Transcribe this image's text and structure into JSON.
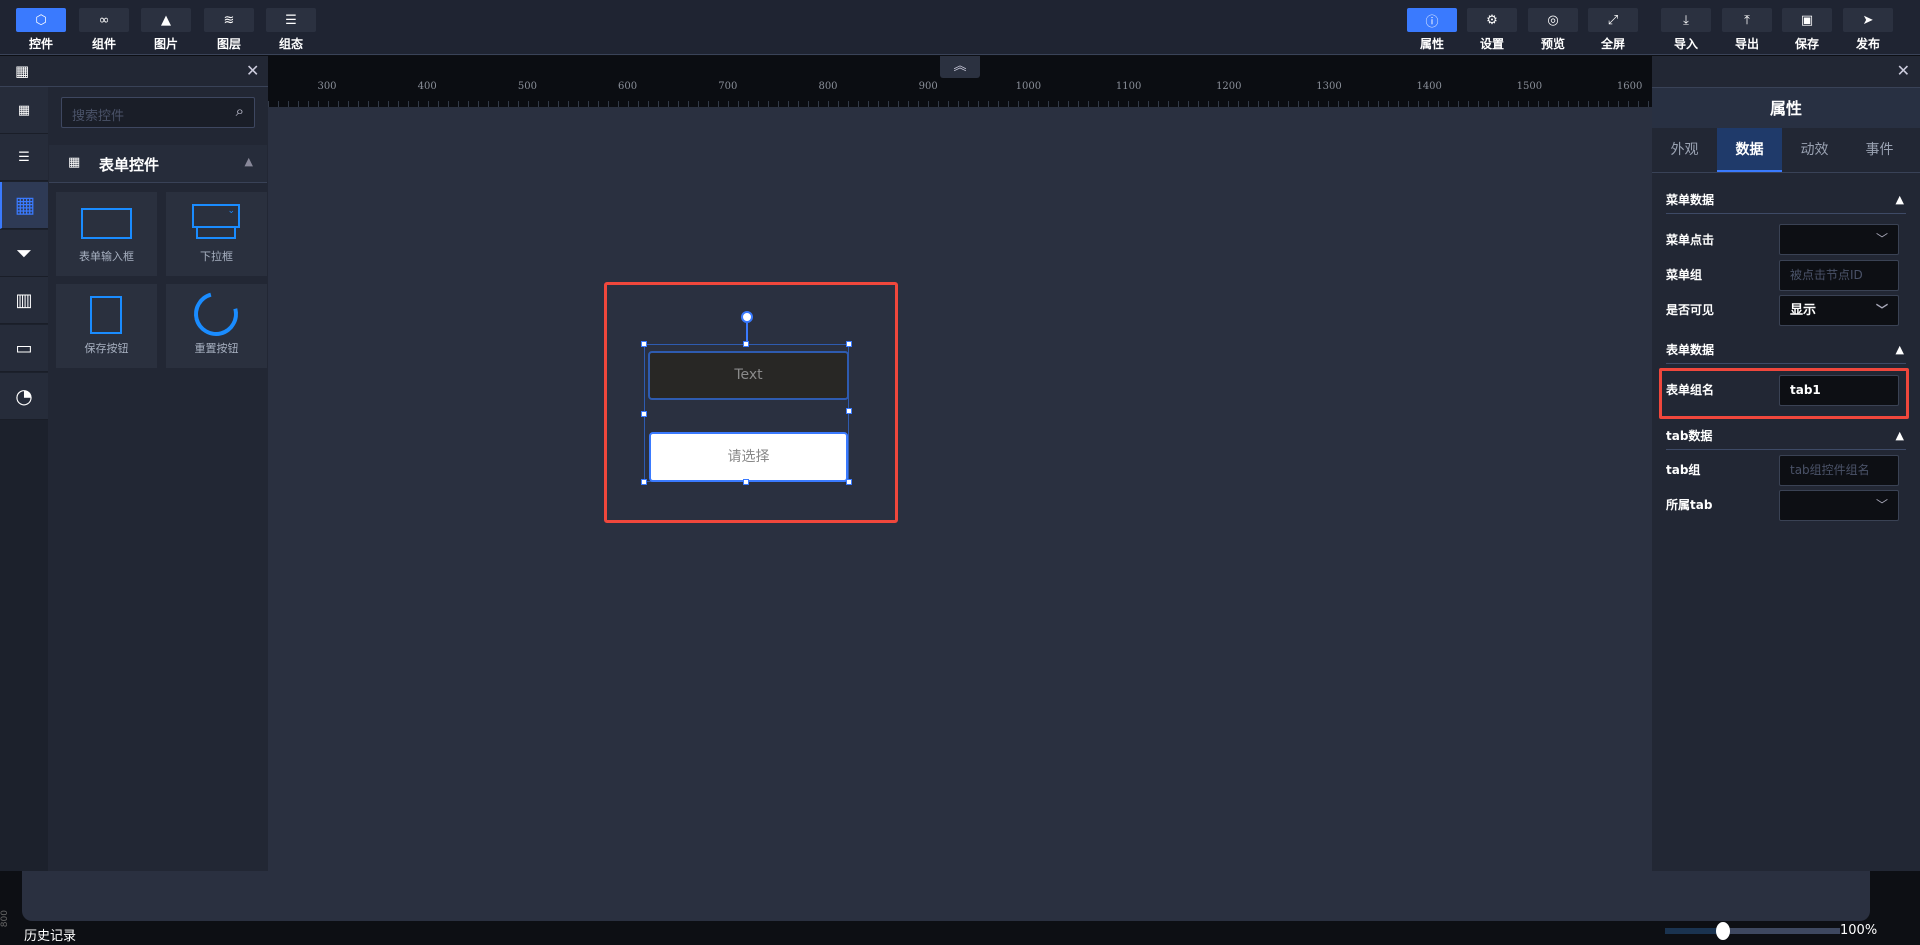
{
  "toolbar": {
    "left": [
      {
        "label": "控件",
        "icon": "cube-icon",
        "active": true
      },
      {
        "label": "组件",
        "icon": "link-icon"
      },
      {
        "label": "图片",
        "icon": "image-icon"
      },
      {
        "label": "图层",
        "icon": "layers-icon"
      },
      {
        "label": "组态",
        "icon": "align-icon"
      }
    ],
    "right": [
      {
        "label": "属性",
        "icon": "info-icon",
        "active": true
      },
      {
        "label": "设置",
        "icon": "gear-icon"
      },
      {
        "label": "预览",
        "icon": "eye-icon"
      },
      {
        "label": "全屏",
        "icon": "fullscreen-icon"
      },
      {
        "label": "导入",
        "icon": "import-icon"
      },
      {
        "label": "导出",
        "icon": "export-icon"
      },
      {
        "label": "保存",
        "icon": "save-icon"
      },
      {
        "label": "发布",
        "icon": "send-icon"
      }
    ]
  },
  "left_panel": {
    "search_placeholder": "搜索控件",
    "section": "表单控件",
    "tiles": [
      {
        "label": "表单输入框"
      },
      {
        "label": "下拉框"
      },
      {
        "label": "保存按钮"
      },
      {
        "label": "重置按钮"
      }
    ]
  },
  "ruler": {
    "ticks": [
      "300",
      "400",
      "500",
      "600",
      "700",
      "800",
      "900",
      "1000",
      "1100",
      "1200",
      "1300",
      "1400",
      "1500",
      "1600"
    ],
    "side_tick": "800"
  },
  "canvas": {
    "text_widget": "Text",
    "select_widget": "请选择"
  },
  "right_panel": {
    "title": "属性",
    "tabs": [
      "外观",
      "数据",
      "动效",
      "事件"
    ],
    "active_tab": "数据",
    "sections": {
      "menu": "菜单数据",
      "form": "表单数据",
      "tab": "tab数据"
    },
    "fields": {
      "menu_click": {
        "label": "菜单点击",
        "value": ""
      },
      "menu_group": {
        "label": "菜单组",
        "placeholder": "被点击节点ID"
      },
      "visible": {
        "label": "是否可见",
        "value": "显示"
      },
      "form_group": {
        "label": "表单组名",
        "value": "tab1"
      },
      "tab_group": {
        "label": "tab组",
        "placeholder": "tab组控件组名"
      },
      "owner_tab": {
        "label": "所属tab",
        "value": ""
      }
    }
  },
  "footer": {
    "history": "历史记录",
    "zoom": "100%",
    "zoom_fraction": 0.33
  },
  "colors": {
    "accent": "#3a7afe",
    "highlight": "#f0473c"
  }
}
